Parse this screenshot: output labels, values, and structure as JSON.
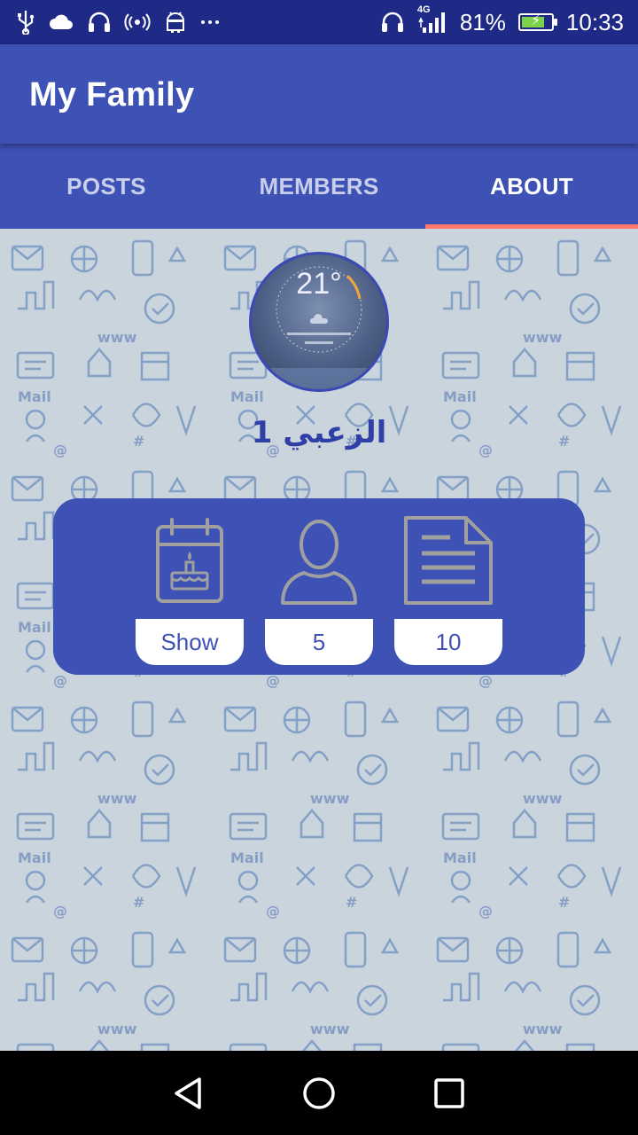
{
  "status_bar": {
    "left_icons": [
      "usb-icon",
      "cloud-icon",
      "headset-icon",
      "hotspot-icon",
      "android-icon",
      "more-dots-icon"
    ],
    "network": "4G",
    "battery_percent": "81%",
    "battery_level": 0.81,
    "time": "10:33"
  },
  "app_bar": {
    "title": "My Family"
  },
  "tabs": [
    {
      "label": "POSTS",
      "active": false
    },
    {
      "label": "MEMBERS",
      "active": false
    },
    {
      "label": "ABOUT",
      "active": true
    }
  ],
  "about": {
    "avatar_temp": "21°",
    "family_name": "الزعبي 1",
    "stats": [
      {
        "icon": "birthday-calendar-icon",
        "value": "Show"
      },
      {
        "icon": "person-icon",
        "value": "5"
      },
      {
        "icon": "document-icon",
        "value": "10"
      }
    ]
  },
  "nav_bar": {
    "buttons": [
      "back-icon",
      "home-icon",
      "recents-icon"
    ]
  },
  "colors": {
    "primary": "#3e51b5",
    "status_bar": "#1e2a86",
    "tab_indicator": "#ff7a6e",
    "background": "#c9d4dc"
  }
}
